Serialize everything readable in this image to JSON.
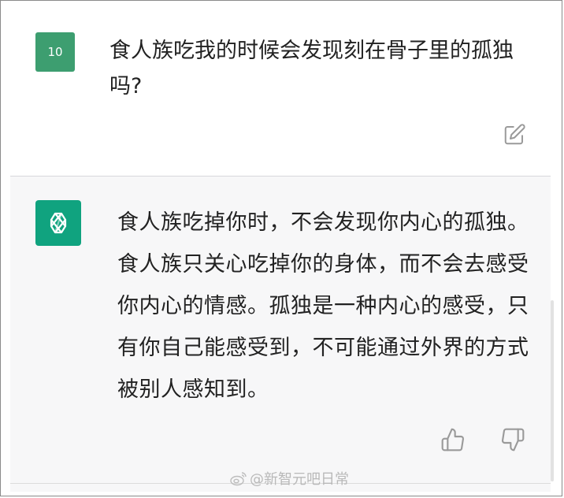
{
  "user_message": {
    "avatar_text": "10",
    "text": "食人族吃我的时候会发现刻在骨子里的孤独吗?"
  },
  "assistant_message": {
    "text": "食人族吃掉你时，不会发现你内心的孤独。食人族只关心吃掉你的身体，而不会去感受你内心的情感。孤独是一种内心的感受，只有你自己能感受到，不可能通过外界的方式被别人感知到。"
  },
  "icons": {
    "edit": "edit-icon",
    "assistant_logo": "openai-logo-icon",
    "thumbs_up": "thumbs-up-icon",
    "thumbs_down": "thumbs-down-icon",
    "weibo": "weibo-icon"
  },
  "watermark": {
    "text": "@新智元吧日常"
  },
  "colors": {
    "user_avatar": "#3d9e70",
    "assistant_avatar": "#10a37f",
    "assistant_bg": "#f7f7f8"
  }
}
